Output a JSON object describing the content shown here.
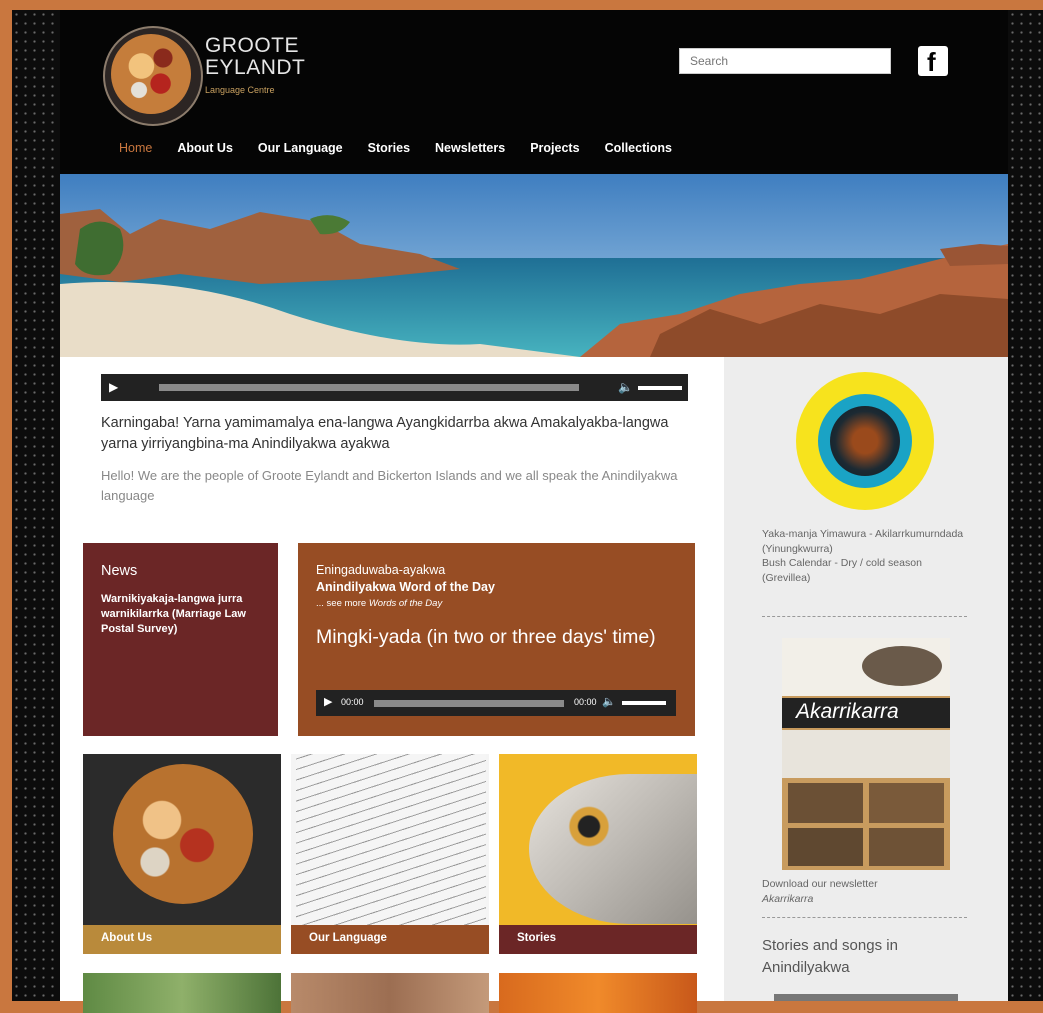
{
  "site": {
    "logo_line1": "GROOTE",
    "logo_line2": "EYLANDT",
    "logo_line3": "Language Centre",
    "search_placeholder": "Search",
    "facebook_icon": "facebook-icon"
  },
  "nav": {
    "items": [
      "Home",
      "About Us",
      "Our Language",
      "Stories",
      "Newsletters",
      "Projects",
      "Collections"
    ],
    "active": "Home"
  },
  "intro": {
    "anindilyakwa": "Karningaba! Yarna yamimamalya ena-langwa Ayangkidarrba akwa Amakalyakba-langwa yarna yirriyangbina-ma Anindilyakwa ayakwa",
    "english": "Hello! We are the people of Groote Eylandt and Bickerton Islands and we all speak the Anindilyakwa language"
  },
  "news": {
    "title": "News",
    "text": "Warnikiyakaja-langwa jurra warnikilarrka (Marriage Law Postal Survey)"
  },
  "wotd": {
    "line1": "Eningaduwaba-ayakwa",
    "line2": "Anindilyakwa Word of the Day",
    "line3_prefix": "... see more ",
    "line3_link": "Words of the Day",
    "phrase": "Mingki-yada (in two or three days' time)",
    "time_start": "00:00",
    "time_end": "00:00"
  },
  "tiles": [
    {
      "label": "About Us",
      "color": "#b98a3b"
    },
    {
      "label": "Our Language",
      "color": "#974d24"
    },
    {
      "label": "Stories",
      "color": "#6b2626"
    }
  ],
  "sidebar": {
    "calendar_text_1": "Yaka-manja Yimawura - Akilarrkumurndada (Yinungkwurra)",
    "calendar_text_2": "Bush Calendar - Dry / cold season  (Grevillea)",
    "newsletter_title": "Akarrikarra",
    "download_text": "Download our newsletter",
    "download_link": "Akarrikarra",
    "stories_heading": "Stories and songs in Anindilyakwa"
  },
  "colors": {
    "accent": "#c9773f",
    "news_bg": "#6b2626",
    "wotd_bg": "#974d24"
  }
}
